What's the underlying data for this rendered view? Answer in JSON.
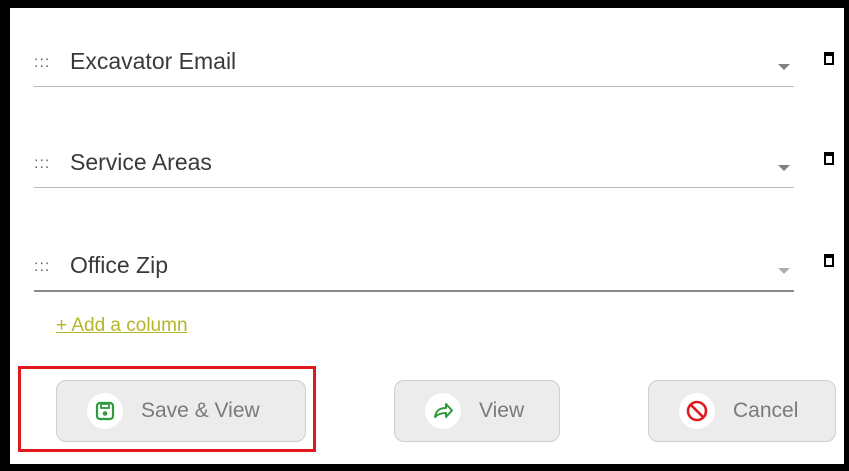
{
  "columns": [
    {
      "label": "Excavator Email"
    },
    {
      "label": "Service Areas"
    },
    {
      "label": "Office Zip"
    }
  ],
  "drag_glyph": ":::",
  "add_column_label": "+ Add a column",
  "buttons": {
    "save_view": "Save & View",
    "view": "View",
    "cancel": "Cancel"
  },
  "colors": {
    "accent_link": "#b5b52a",
    "save_icon": "#2e9a3e",
    "view_icon": "#2e9a3e",
    "cancel_icon": "#e0191f",
    "highlight": "#e0191f"
  },
  "icons": {
    "drag": "drag-handle-icon",
    "caret": "chevron-down-icon",
    "delete": "trash-icon",
    "save": "floppy-disk-icon",
    "view": "share-arrow-icon",
    "cancel": "prohibited-icon"
  }
}
